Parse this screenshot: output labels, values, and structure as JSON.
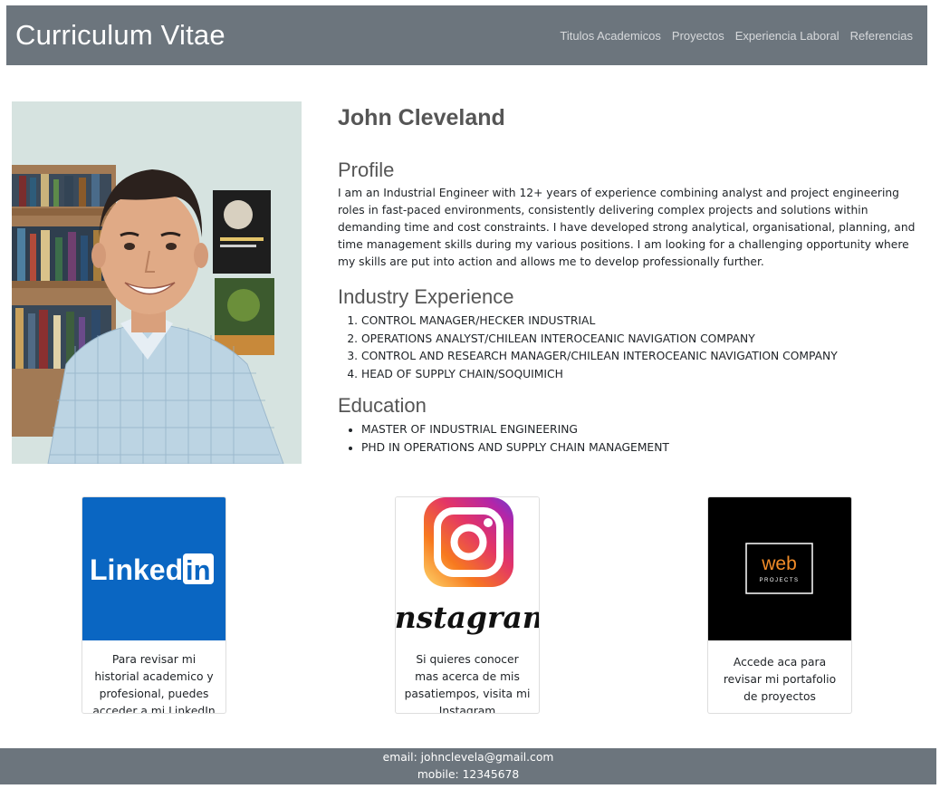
{
  "header": {
    "brand": "Curriculum Vitae",
    "nav": [
      "Titulos Academicos",
      "Proyectos",
      "Experiencia Laboral",
      "Referencias"
    ]
  },
  "person": {
    "name": "John Cleveland"
  },
  "profile": {
    "title": "Profile",
    "text": "I am an Industrial Engineer with 12+ years of experience combining analyst and project engineering roles in fast-paced environments, consistently delivering complex projects and solutions within demanding time and cost constraints. I have developed strong analytical, organisational, planning, and time management skills during my various positions. I am looking for a challenging opportunity where my skills are put into action and allows me to develop professionally further."
  },
  "experience": {
    "title": "Industry Experience",
    "items": [
      "CONTROL MANAGER/HECKER INDUSTRIAL",
      "OPERATIONS ANALYST/CHILEAN INTEROCEANIC NAVIGATION COMPANY",
      "CONTROL AND RESEARCH MANAGER/CHILEAN INTEROCEANIC NAVIGATION COMPANY",
      "HEAD OF SUPPLY CHAIN/SOQUIMICH"
    ]
  },
  "education": {
    "title": "Education",
    "items": [
      "MASTER OF INDUSTRIAL ENGINEERING",
      "PHD IN OPERATIONS AND SUPPLY CHAIN MANAGEMENT"
    ]
  },
  "cards": {
    "linkedin": {
      "logo_text": "Linked",
      "logo_in": "in",
      "text": "Para revisar mi historial academico y profesional, puedes acceder a mi LinkedIn"
    },
    "instagram": {
      "logo_text": "Instagram",
      "text": "Si quieres conocer mas acerca de mis pasatiempos, visita mi Instagram"
    },
    "web": {
      "logo_text": "web",
      "logo_sub": "PROJECTS",
      "text": "Accede aca para revisar mi portafolio de proyectos"
    }
  },
  "footer": {
    "email": "email: johnclevela@gmail.com",
    "mobile": "mobile: 12345678"
  },
  "colors": {
    "navbar": "#6c757d",
    "linkedin_blue": "#0a66c2",
    "web_orange": "#f28c28"
  }
}
